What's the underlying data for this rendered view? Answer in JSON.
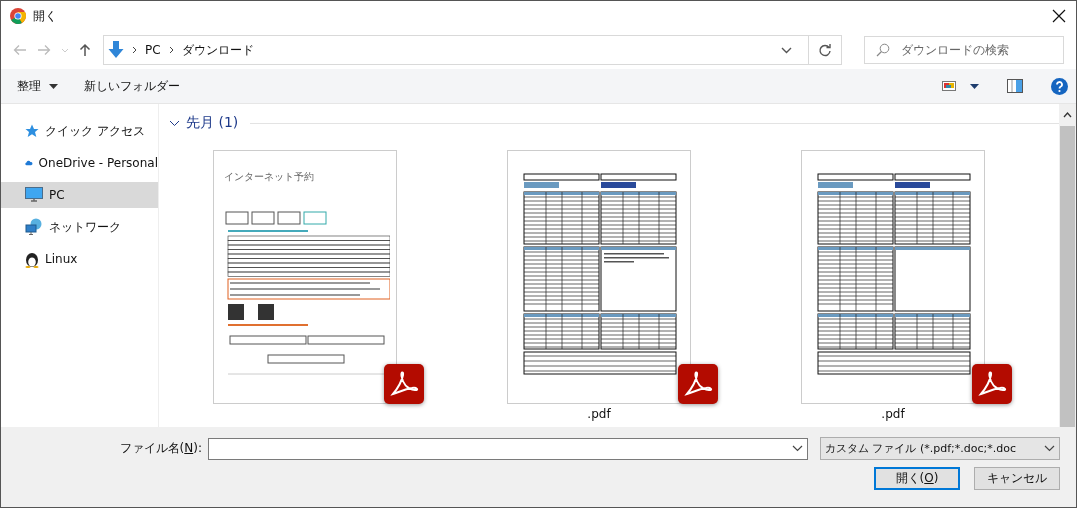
{
  "window": {
    "title": "開く"
  },
  "address": {
    "crumbs": [
      "PC",
      "ダウンロード"
    ]
  },
  "search": {
    "placeholder": "ダウンロードの検索"
  },
  "toolbar": {
    "organize": "整理",
    "new_folder": "新しいフォルダー"
  },
  "sidebar": {
    "items": [
      {
        "kind": "quick",
        "label": "クイック アクセス",
        "selected": false
      },
      {
        "kind": "cloud",
        "label": "OneDrive - Personal",
        "selected": false
      },
      {
        "kind": "pc",
        "label": "PC",
        "selected": true
      },
      {
        "kind": "network",
        "label": "ネットワーク",
        "selected": false
      },
      {
        "kind": "linux",
        "label": "Linux",
        "selected": false
      }
    ]
  },
  "group": {
    "label": "先月 (1)",
    "expanded": true
  },
  "files": [
    {
      "kind": "web",
      "heading": "インターネット予約"
    },
    {
      "kind": "sheet",
      "name": ".pdf",
      "notes": true
    },
    {
      "kind": "sheet",
      "name": ".pdf",
      "notes": false
    }
  ],
  "footer": {
    "filename_label": "ファイル名(",
    "filename_key": "N",
    "filename_end": "):",
    "filter": "カスタム ファイル (*.pdf;*.doc;*.doc",
    "open": "開く(",
    "open_key": "O",
    "open_end": ")",
    "cancel": "キャンセル"
  }
}
